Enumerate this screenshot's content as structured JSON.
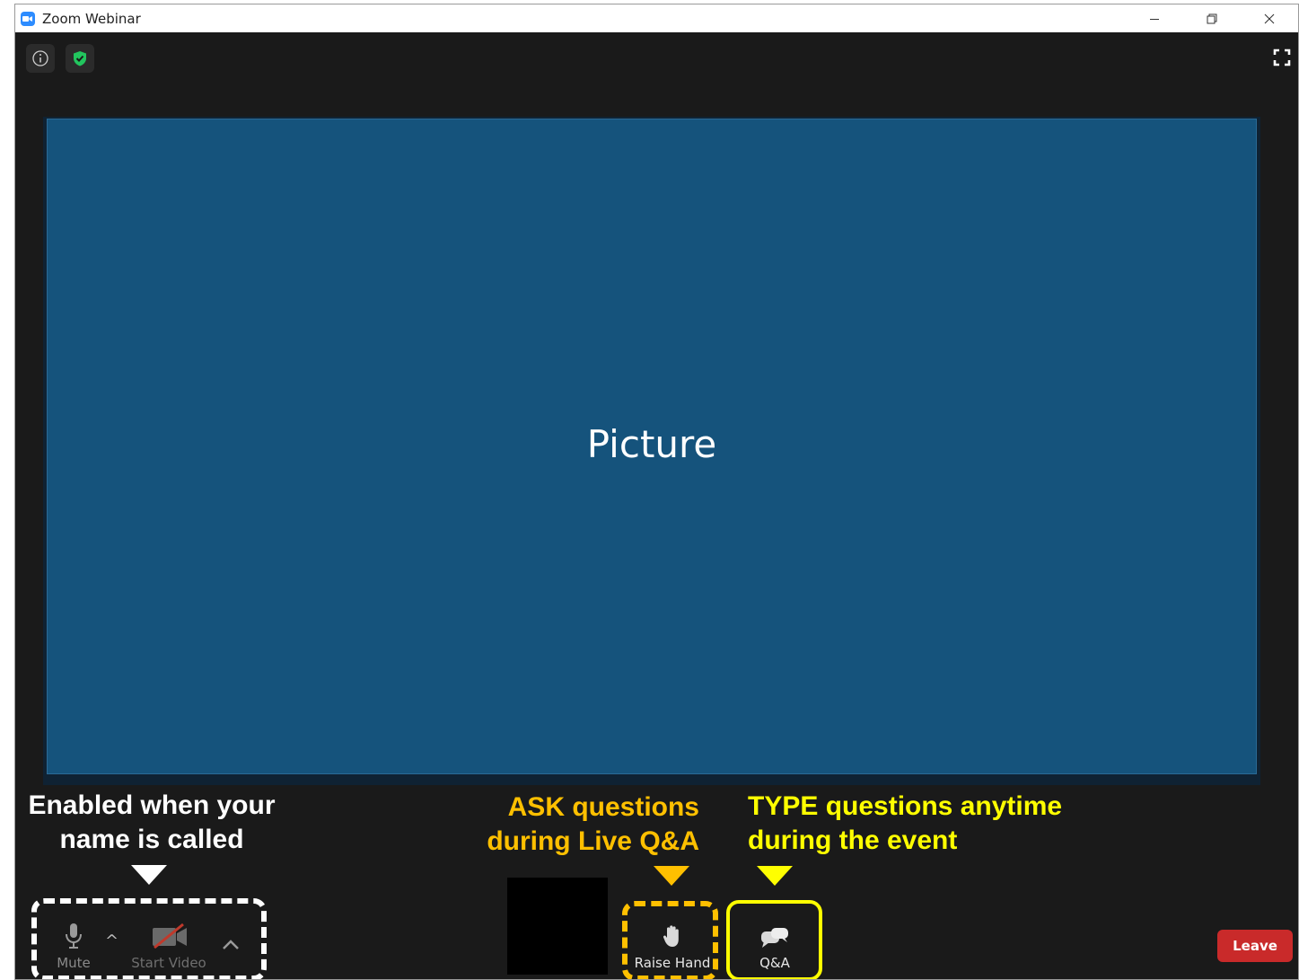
{
  "window": {
    "title": "Zoom Webinar",
    "accent": "#2d8cff"
  },
  "stage": {
    "label": "Picture",
    "background": "#15537c"
  },
  "callouts": {
    "white": [
      "Enabled when your",
      "name is called"
    ],
    "orange": [
      "ASK questions",
      "during Live Q&A"
    ],
    "yellow": [
      "TYPE questions anytime",
      "during the event"
    ]
  },
  "toolbar": {
    "mute_label": "Mute",
    "video_label": "Start Video",
    "raise_hand_label": "Raise Hand",
    "qa_label": "Q&A",
    "leave_label": "Leave"
  },
  "colors": {
    "callout_white": "#ffffff",
    "callout_orange": "#ffc000",
    "callout_yellow": "#ffff00",
    "leave": "#c92a2a"
  }
}
